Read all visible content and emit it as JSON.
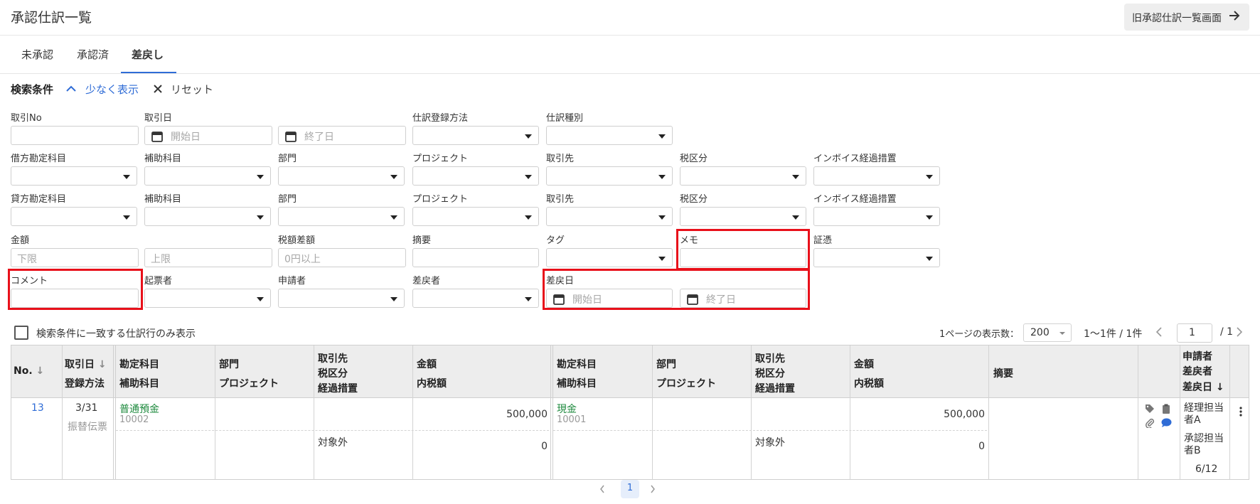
{
  "header": {
    "title": "承認仕訳一覧",
    "old_button": "旧承認仕訳一覧画面"
  },
  "tabs": [
    {
      "label": "未承認"
    },
    {
      "label": "承認済"
    },
    {
      "label": "差戻し"
    }
  ],
  "search": {
    "title": "検索条件",
    "less_label": "少なく表示",
    "reset_label": "リセット",
    "labels": {
      "txn_no": "取引No",
      "txn_date": "取引日",
      "reg_method": "仕訳登録方法",
      "entry_type": "仕訳種別",
      "debit_account": "借方勘定科目",
      "sub_account": "補助科目",
      "department": "部門",
      "project": "プロジェクト",
      "partner": "取引先",
      "tax_class": "税区分",
      "invoice": "インボイス経過措置",
      "credit_account": "貸方勘定科目",
      "amount": "金額",
      "tax_diff": "税額差額",
      "summary": "摘要",
      "tag": "タグ",
      "memo": "メモ",
      "evidence": "証憑",
      "comment": "コメント",
      "creator": "起票者",
      "applicant": "申請者",
      "returner": "差戻者",
      "return_date": "差戻日"
    },
    "placeholders": {
      "start": "開始日",
      "end": "終了日",
      "lower": "下限",
      "upper": "上限",
      "tax_min": "0円以上"
    }
  },
  "list": {
    "only_matching": "検索条件に一致する仕訳行のみ表示",
    "per_page_label": "1ページの表示数：",
    "per_page": "200",
    "range": "1〜1件 / 1件",
    "page": "1",
    "total_pages": "/ 1"
  },
  "table": {
    "headers": {
      "no": "No.",
      "date": "取引日",
      "method": "登録方法",
      "account": "勘定科目",
      "sub": "補助科目",
      "dept": "部門",
      "proj": "プロジェクト",
      "partner": "取引先",
      "tax": "税区分",
      "trans": "経過措置",
      "amount": "金額",
      "inner_tax": "内税額",
      "summary": "摘要",
      "applicant": "申請者",
      "returner": "差戻者",
      "return_date": "差戻日"
    },
    "row": {
      "no": "13",
      "date": "3/31",
      "method": "振替伝票",
      "debit_account": "普通預金",
      "debit_code": "10002",
      "debit_tax": "対象外",
      "debit_amount": "500,000",
      "debit_inner": "0",
      "credit_account": "現金",
      "credit_code": "10001",
      "credit_tax": "対象外",
      "credit_amount": "500,000",
      "credit_inner": "0",
      "applicant": "経理担当者A",
      "returner": "承認担当者B",
      "return_date": "6/12"
    }
  },
  "pagination": {
    "current": "1"
  },
  "colors": {
    "accent": "#2f6cd6",
    "highlight": "#e8101a",
    "account_green": "#1e8a3e"
  }
}
